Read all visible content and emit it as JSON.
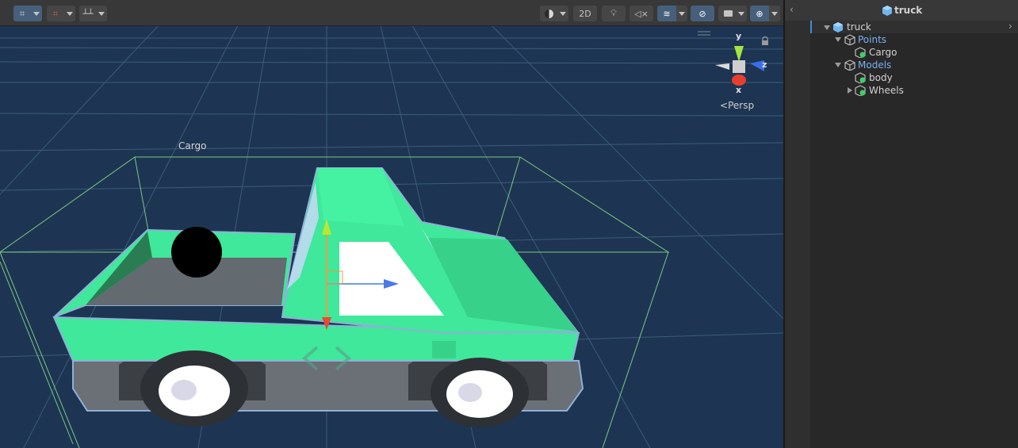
{
  "toolbar": {
    "btn_2d": "2D"
  },
  "scene": {
    "cargo_label": "Cargo",
    "gizmo": {
      "y_label": "y",
      "z_label": "z",
      "x_label": "x",
      "persp_label": "Persp"
    }
  },
  "hierarchy": {
    "title": "truck",
    "items": [
      {
        "label": "truck"
      },
      {
        "label": "Points"
      },
      {
        "label": "Cargo"
      },
      {
        "label": "Models"
      },
      {
        "label": "body"
      },
      {
        "label": "Wheels"
      }
    ]
  },
  "colors": {
    "scene_bg": "#1d3552",
    "truck_body": "#3fe89a",
    "selection_outline": "#8fb0d8",
    "bounds": "#8de08d"
  }
}
